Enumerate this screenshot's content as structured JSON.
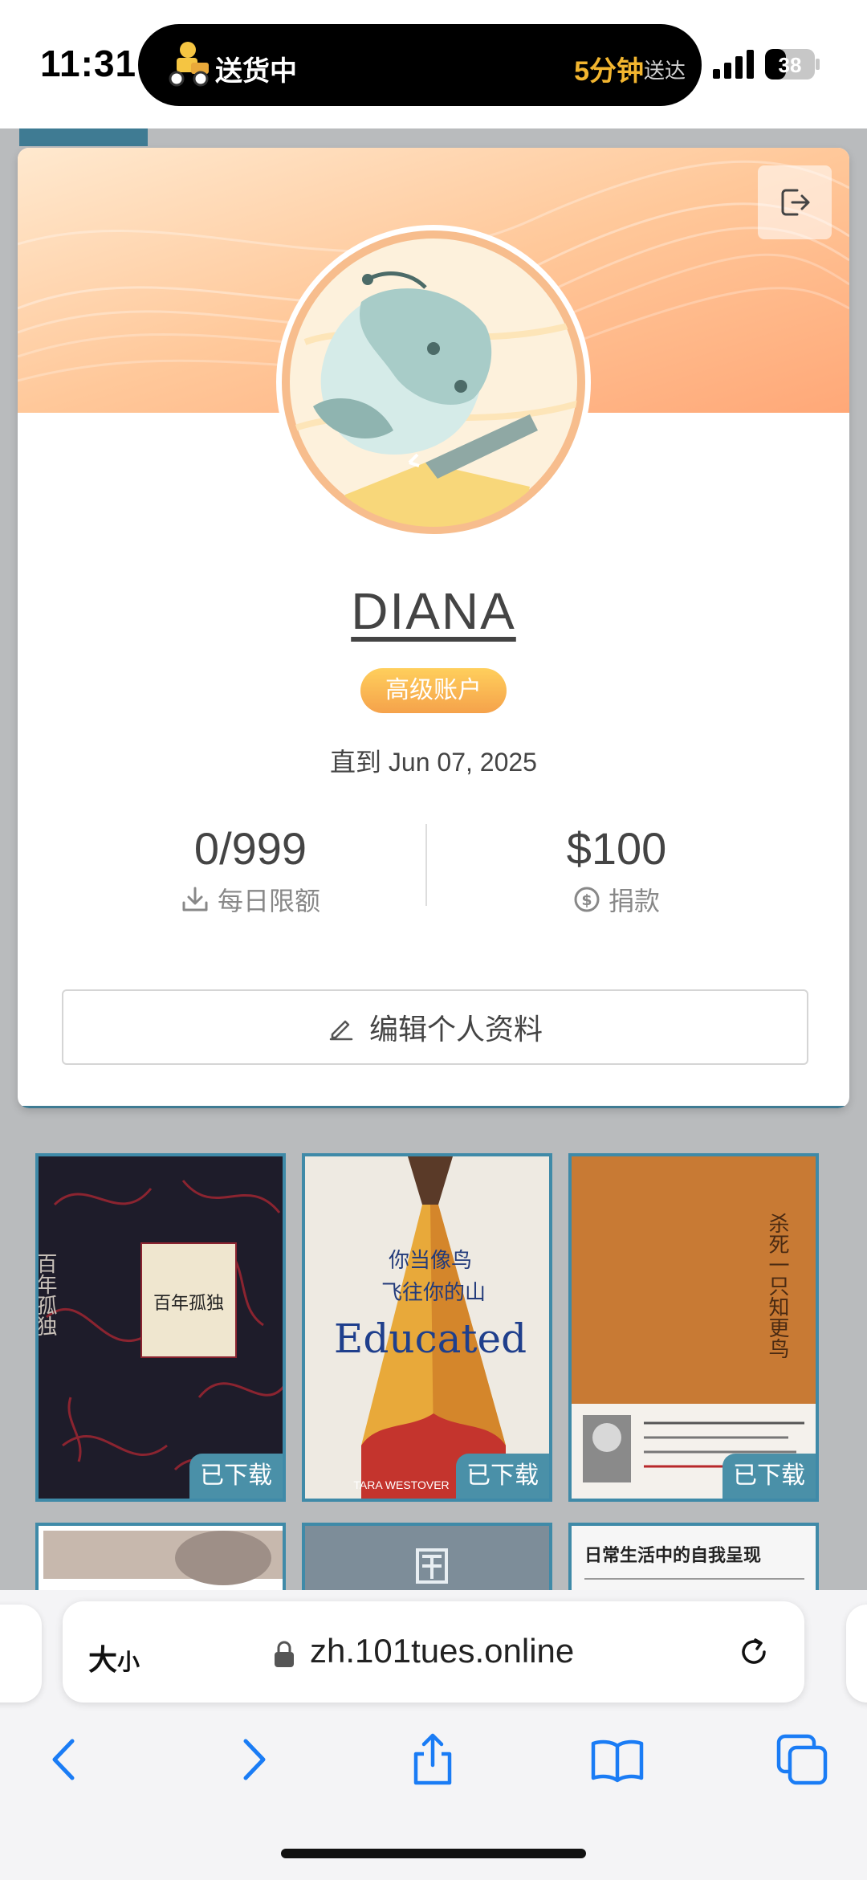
{
  "status_bar": {
    "time": "11:31",
    "activity_label": "送货中",
    "eta_value": "5分钟",
    "eta_suffix": "送达",
    "battery": "38"
  },
  "profile": {
    "username": "DIANA",
    "badge": "高级账户",
    "until": "直到 Jun 07, 2025",
    "daily_limit_value": "0/999",
    "daily_limit_label": "每日限额",
    "donation_value": "$100",
    "donation_label": "捐款",
    "edit_label": "编辑个人资料"
  },
  "books": [
    {
      "status": "已下载",
      "cover_title": "百年孤独",
      "cover_color": "#1e1c2a"
    },
    {
      "status": "已下载",
      "cover_title_line1": "你当像鸟",
      "cover_title_line2": "飞往你的山",
      "cover_en": "Educated",
      "cover_author": "TARA WESTOVER",
      "cover_color": "#eeeae2"
    },
    {
      "status": "已下载",
      "cover_title": "杀死一只知更鸟",
      "cover_color": "#c87a34"
    },
    {
      "cover_color": "#c7b8ad"
    },
    {
      "cover_color": "#7d8d99"
    },
    {
      "cover_title": "日常生活中的自我呈现",
      "cover_color": "#f6f6f6"
    }
  ],
  "browser": {
    "text_size_label": "大",
    "text_size_label_small": "小",
    "url": "zh.101tues.online"
  },
  "colors": {
    "accent": "#3f8aa8",
    "badge": "#f5a24b",
    "eta": "#f2b52f"
  }
}
